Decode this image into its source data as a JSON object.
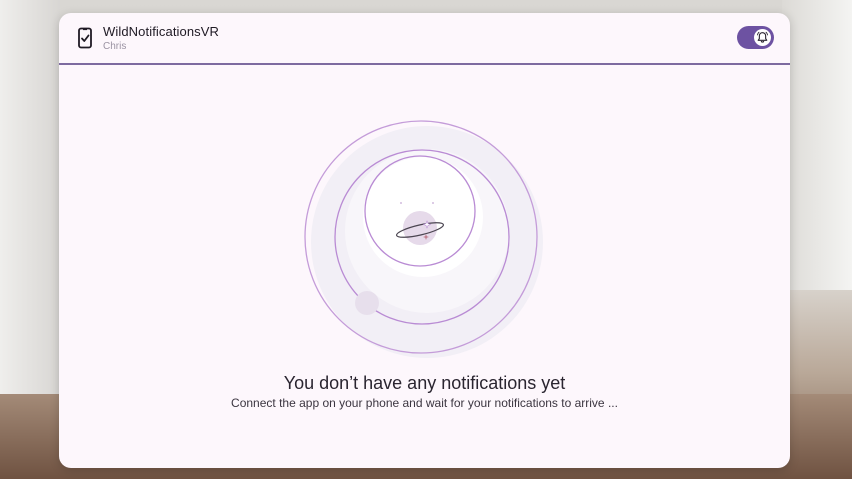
{
  "header": {
    "app_title": "WildNotificationsVR",
    "user_name": "Chris",
    "device_icon": "phone-check-icon",
    "toggle": {
      "state": "on",
      "icon": "bell-icon"
    }
  },
  "empty_state": {
    "title": "You don’t have any notifications yet",
    "subtitle": "Connect the app on your phone and wait for your notifications to arrive ...",
    "illustration_icon": "planet-orbit-icon"
  },
  "colors": {
    "accent": "#6d52a2",
    "panel_background": "#fdf7fc",
    "orbit_line": "#b58fd0",
    "header_divider": "#7d6aa0"
  }
}
